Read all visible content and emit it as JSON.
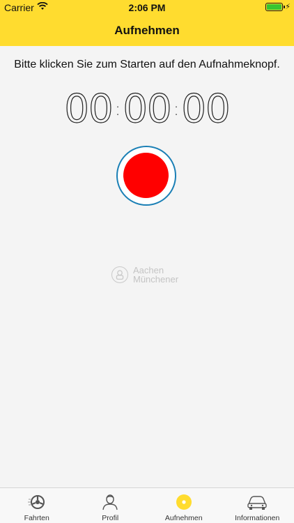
{
  "status_bar": {
    "carrier": "Carrier",
    "time": "2:06 PM"
  },
  "nav": {
    "title": "Aufnehmen"
  },
  "instruction": "Bitte klicken Sie zum Starten auf den Aufnahmeknopf.",
  "timer": {
    "hours": "00",
    "minutes": "00",
    "seconds": "00"
  },
  "logo": {
    "line1": "Aachen",
    "line2": "Münchener"
  },
  "tabs": [
    {
      "label": "Fahrten",
      "icon": "steering-wheel-icon"
    },
    {
      "label": "Profil",
      "icon": "profile-icon"
    },
    {
      "label": "Aufnehmen",
      "icon": "record-dot-icon"
    },
    {
      "label": "Informationen",
      "icon": "car-icon"
    }
  ],
  "colors": {
    "header": "#ffdc2f",
    "record": "#ff0000",
    "record_ring": "#1a7fb5",
    "active_tab": "#ffdc2f"
  }
}
